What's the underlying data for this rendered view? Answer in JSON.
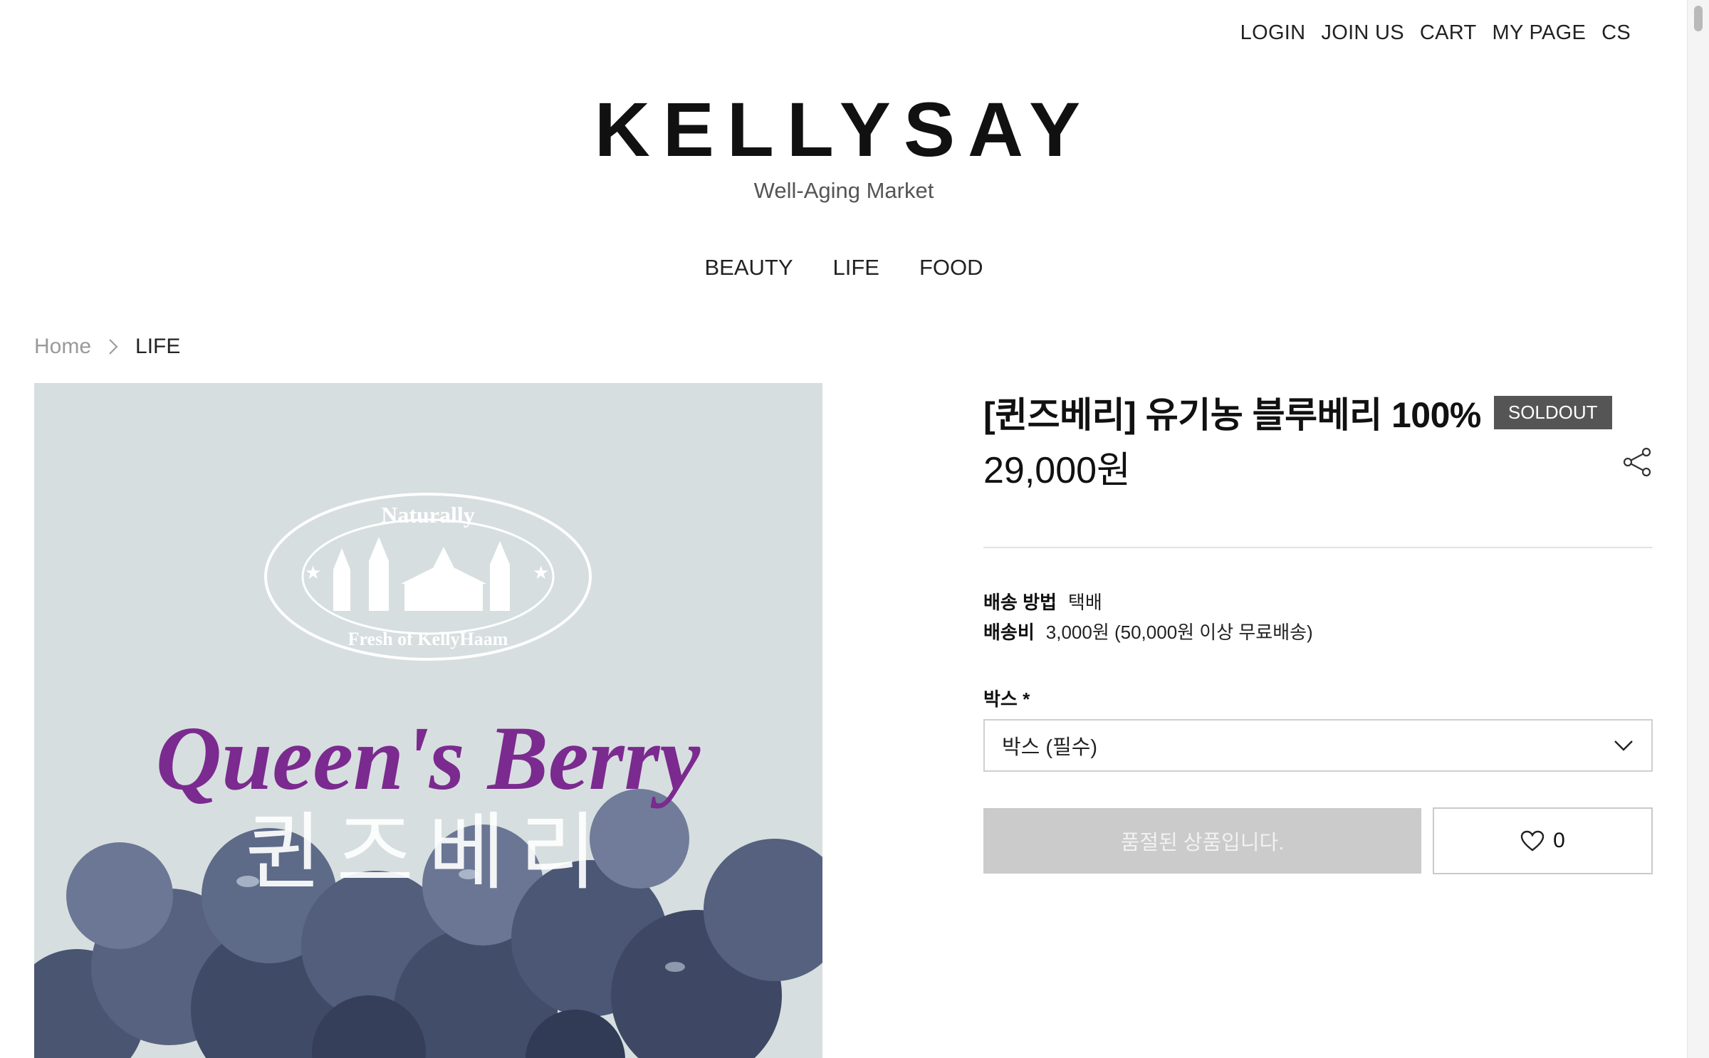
{
  "top_nav": [
    "LOGIN",
    "JOIN US",
    "CART",
    "MY PAGE",
    "CS"
  ],
  "logo": {
    "text": "KELLYSAY",
    "tagline": "Well-Aging Market"
  },
  "main_nav": [
    "BEAUTY",
    "LIFE",
    "FOOD"
  ],
  "breadcrumb": {
    "home": "Home",
    "current": "LIFE"
  },
  "product": {
    "image_text": {
      "seal_top": "Naturally",
      "seal_bottom": "Fresh of KellyHaam",
      "brand": "Queen's Berry",
      "brand_korean": "퀸즈베리"
    },
    "title": "[퀸즈베리] 유기농 블루베리 100%",
    "badge": "SOLDOUT",
    "price": "29,000원",
    "shipping": {
      "method_label": "배송 방법",
      "method_value": "택배",
      "fee_label": "배송비",
      "fee_value": "3,000원 (50,000원 이상 무료배송)"
    },
    "option": {
      "label": "박스 *",
      "selected": "박스 (필수)"
    },
    "soldout_button": "품절된 상품입니다.",
    "wishlist_count": "0"
  },
  "colors": {
    "badge_bg": "#555555",
    "soldout_button_bg": "#cbcbcb",
    "brand_purple": "#7b2a8f",
    "image_bg": "#d7dedf"
  }
}
